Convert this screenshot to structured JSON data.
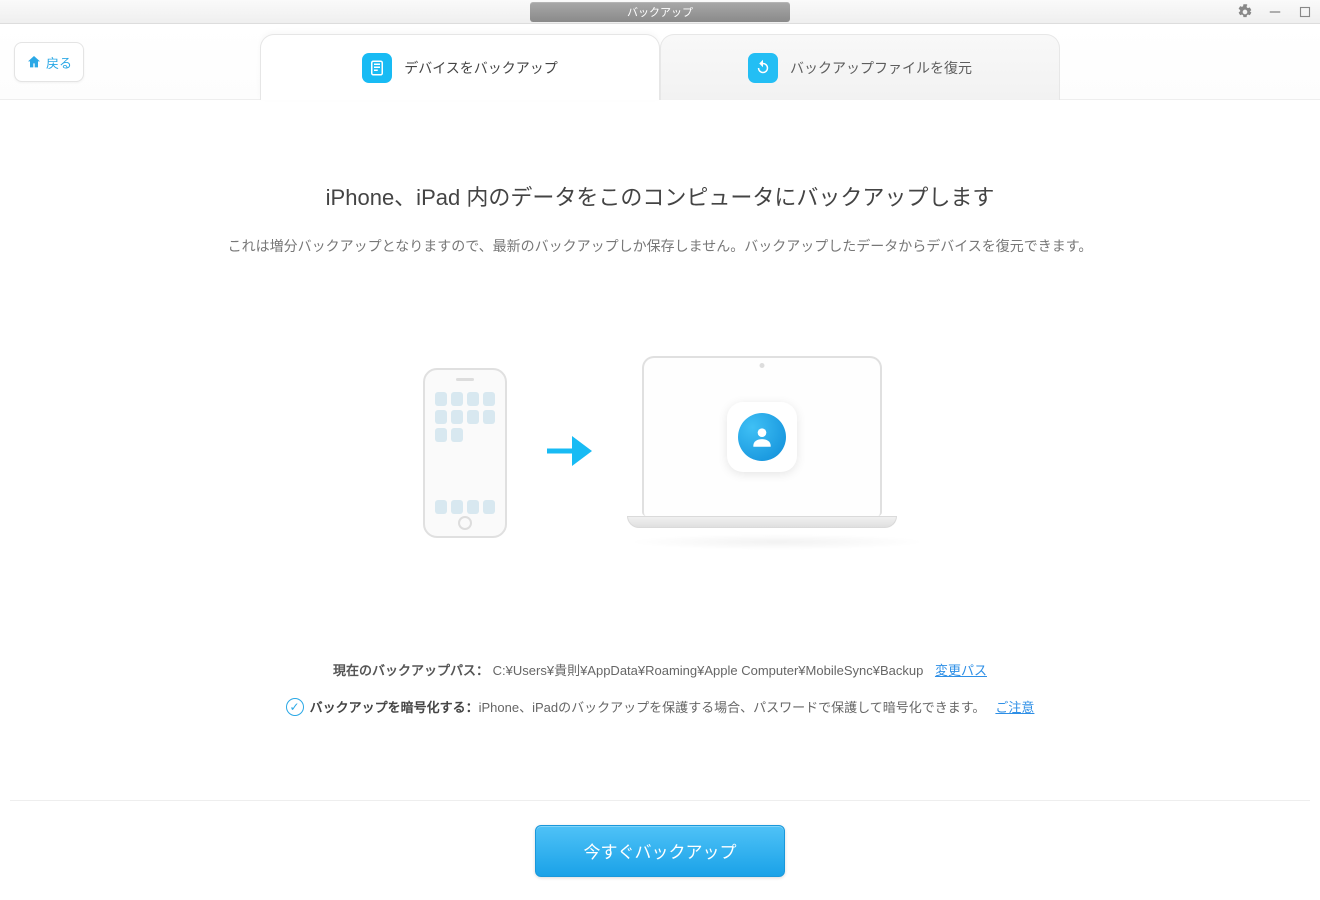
{
  "titlebar": {
    "label": "バックアップ"
  },
  "header": {
    "back_label": "戻る",
    "tabs": [
      {
        "label": "デバイスをバックアップ"
      },
      {
        "label": "バックアップファイルを復元"
      }
    ]
  },
  "main": {
    "title": "iPhone、iPad 内のデータをこのコンピュータにバックアップします",
    "subtitle": "これは増分バックアップとなりますので、最新のバックアップしか保存しません。バックアップしたデータからデバイスを復元できます。"
  },
  "paths": {
    "label": "現在のバックアップパス：",
    "value": "C:¥Users¥貴則¥AppData¥Roaming¥Apple Computer¥MobileSync¥Backup",
    "change_link": "変更パス"
  },
  "encrypt": {
    "bold_label": "バックアップを暗号化する：",
    "description": "iPhone、iPadのバックアップを保護する場合、パスワードで保護して暗号化できます。",
    "notice_link": "ご注意"
  },
  "footer": {
    "primary_button": "今すぐバックアップ"
  }
}
